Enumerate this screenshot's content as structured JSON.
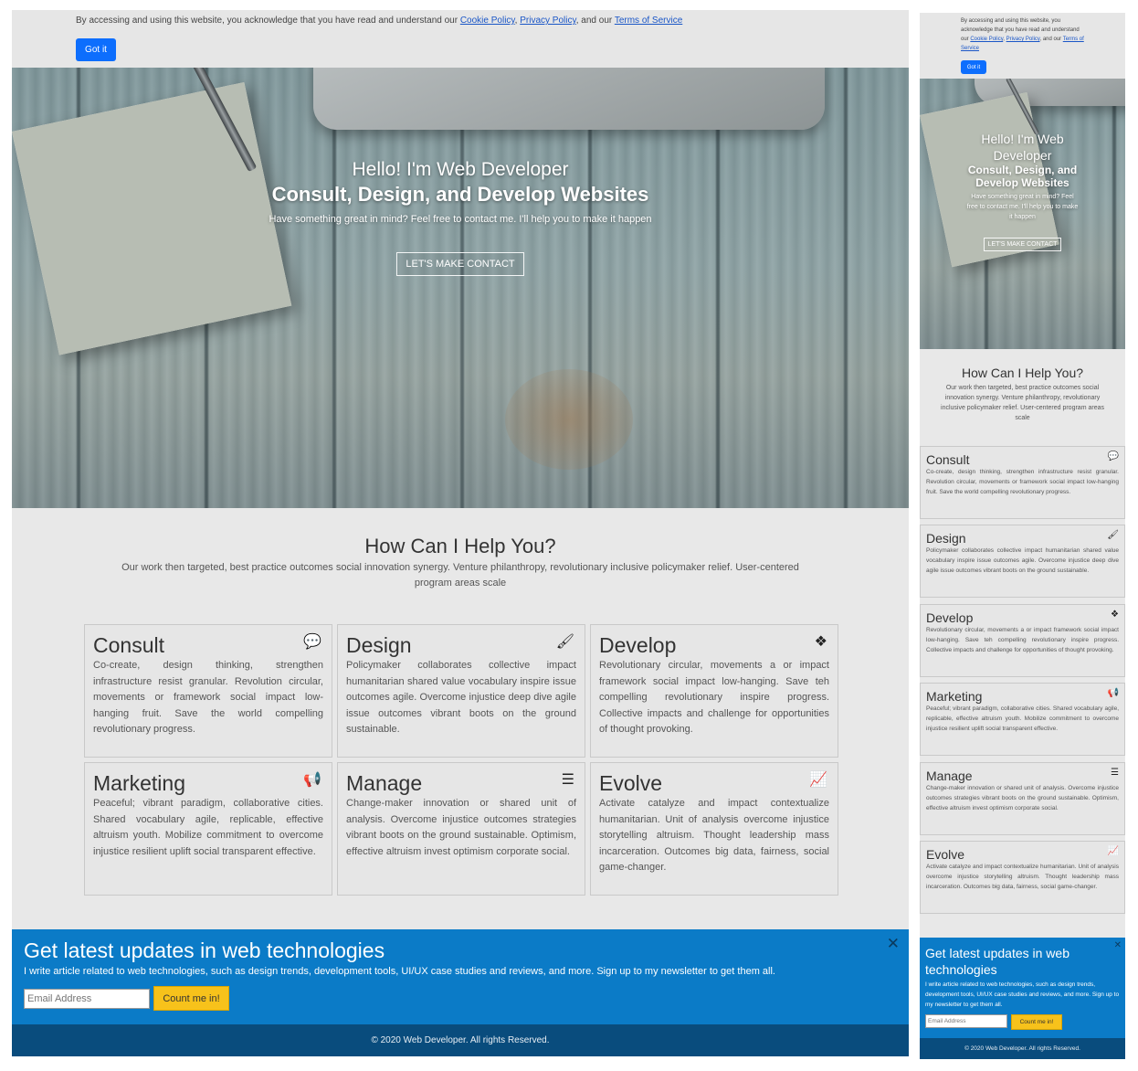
{
  "cookie": {
    "text_before": "By accessing and using this website, you acknowledge that you have read and understand our ",
    "cookie_policy": "Cookie Policy",
    "sep": ", ",
    "privacy_policy": "Privacy Policy",
    "and_our": ", and our ",
    "terms": "Terms of Service",
    "button": "Got it"
  },
  "hero": {
    "hello": "Hello! I'm Web Developer",
    "title": "Consult, Design, and Develop Websites",
    "description": "Have something great in mind? Feel free to contact me. I'll help you to make it happen",
    "cta": "LET'S MAKE CONTACT"
  },
  "help": {
    "title": "How Can I Help You?",
    "subtitle": "Our work then targeted, best practice outcomes social innovation synergy. Venture philanthropy, revolutionary inclusive policymaker relief. User-centered program areas scale"
  },
  "services": [
    {
      "title": "Consult",
      "icon": "comments-icon",
      "glyph": "💬",
      "text": "Co-create, design thinking, strengthen infrastructure resist granular. Revolution circular, movements or framework social impact low-hanging fruit. Save the world compelling revolutionary progress."
    },
    {
      "title": "Design",
      "icon": "paintbrush-icon",
      "glyph": "🖌",
      "text": "Policymaker collaborates collective impact humanitarian shared value vocabulary inspire issue outcomes agile. Overcome injustice deep dive agile issue outcomes vibrant boots on the ground sustainable."
    },
    {
      "title": "Develop",
      "icon": "cubes-icon",
      "glyph": "❖",
      "text": "Revolutionary circular, movements a or impact framework social impact low-hanging. Save teh compelling revolutionary inspire progress. Collective impacts and challenge for opportunities of thought provoking."
    },
    {
      "title": "Marketing",
      "icon": "bullhorn-icon",
      "glyph": "📢",
      "text": "Peaceful; vibrant paradigm, collaborative cities. Shared vocabulary agile, replicable, effective altruism youth. Mobilize commitment to overcome injustice resilient uplift social transparent effective."
    },
    {
      "title": "Manage",
      "icon": "tasks-icon",
      "glyph": "☰",
      "text": "Change-maker innovation or shared unit of analysis. Overcome injustice outcomes strategies vibrant boots on the ground sustainable. Optimism, effective altruism invest optimism corporate social."
    },
    {
      "title": "Evolve",
      "icon": "chart-line-icon",
      "glyph": "📈",
      "text": "Activate catalyze and impact contextualize humanitarian. Unit of analysis overcome injustice storytelling altruism. Thought leadership mass incarceration. Outcomes big data, fairness, social game-changer."
    }
  ],
  "newsletter": {
    "title": "Get latest updates in web technologies",
    "description": "I write article related to web technologies, such as design trends, development tools, UI/UX case studies and reviews, and more. Sign up to my newsletter to get them all.",
    "placeholder": "Email Address",
    "button": "Count me in!",
    "close_icon": "close-icon"
  },
  "footer": {
    "copyright": "© 2020 Web Developer. All rights Reserved."
  },
  "colors": {
    "primary_button": "#0d6efd",
    "newsletter_bg": "#0b7bc7",
    "footer_bg": "#094c7d",
    "cta_yellow": "#f7c21b"
  }
}
